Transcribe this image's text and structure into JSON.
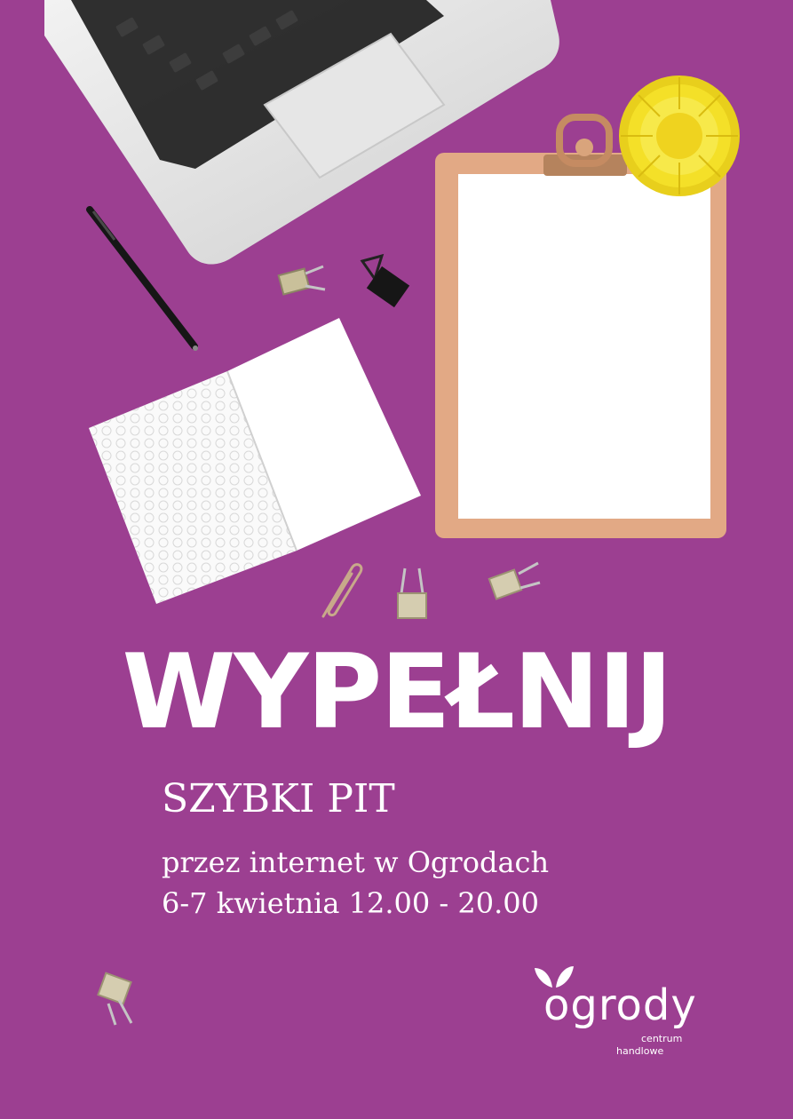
{
  "headline": "WYPEŁNIJ",
  "subheadline": "SZYBKI PIT",
  "details": {
    "line1": "przez internet w Ogrodach",
    "line2": "6-7 kwietnia 12.00 - 20.00"
  },
  "logo": {
    "wordmark": "ogrody",
    "sub1": "centrum",
    "sub2": "handlowe"
  },
  "colors": {
    "background": "#9c3f91",
    "text": "#ffffff",
    "clipboard": "#e2a985",
    "flower": "#f4e028"
  },
  "icons": [
    "laptop-icon",
    "pen-icon",
    "binder-clip-icon",
    "paper-clip-icon",
    "notebook-icon",
    "clipboard-icon",
    "flower-icon",
    "ogrody-logo-icon"
  ]
}
